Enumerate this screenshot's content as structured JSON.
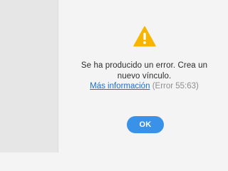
{
  "dialog": {
    "icon": "warning-icon",
    "message": "Se ha producido un error. Crea un nuevo vínculo.",
    "more_info_label": "Más información",
    "error_code": "(Error 55:63)",
    "ok_label": "OK"
  },
  "colors": {
    "background": "#f4f4f4",
    "sidebar": "#e6e6e6",
    "warning": "#f7b500",
    "link": "#1a6fd1",
    "button": "#3a92e8"
  }
}
